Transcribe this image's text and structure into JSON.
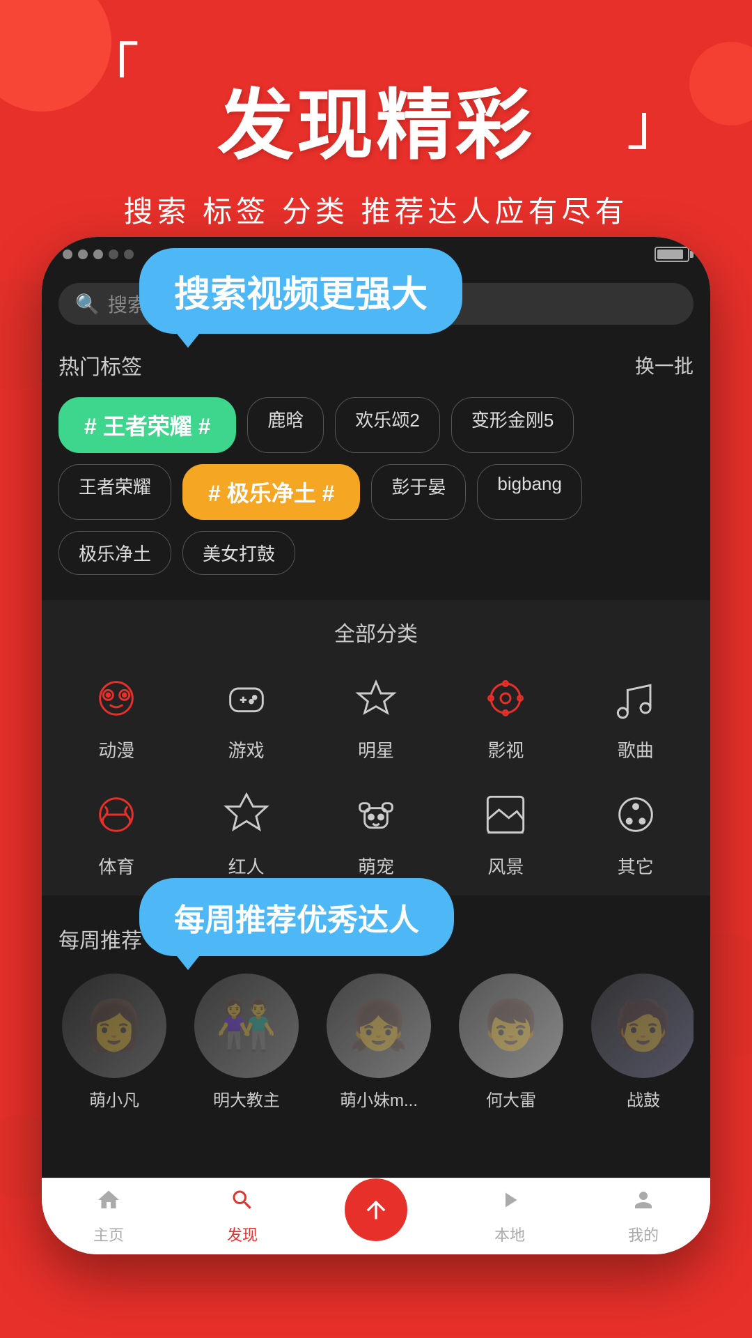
{
  "background": {
    "color": "#e8302a"
  },
  "header": {
    "bracket_open": "「",
    "bracket_close": "」",
    "title": "发现精彩",
    "subtitle": "搜索 标签 分类 推荐达人应有尽有"
  },
  "bubble_search": "搜索视频更强大",
  "bubble_recommend": "每周推荐优秀达人",
  "phone": {
    "statusbar_dots": [
      "filled",
      "filled",
      "filled",
      "empty",
      "empty"
    ],
    "search_placeholder": "搜索视频、标签、用户"
  },
  "hot_tags": {
    "title": "热门标签",
    "action": "换一批",
    "tags": [
      {
        "label": "# 王者荣耀 #",
        "style": "green"
      },
      {
        "label": "鹿晗",
        "style": "normal"
      },
      {
        "label": "欢乐颂2",
        "style": "normal"
      },
      {
        "label": "变形金刚5",
        "style": "normal"
      },
      {
        "label": "王者荣耀",
        "style": "normal"
      },
      {
        "label": "# 极乐净土 #",
        "style": "yellow"
      },
      {
        "label": "彭于晏",
        "style": "normal"
      },
      {
        "label": "bigbang",
        "style": "normal"
      },
      {
        "label": "极乐净土",
        "style": "normal"
      },
      {
        "label": "美女打鼓",
        "style": "normal"
      }
    ]
  },
  "categories": {
    "title": "全部分类",
    "items": [
      {
        "label": "动漫",
        "icon": "anime"
      },
      {
        "label": "游戏",
        "icon": "game"
      },
      {
        "label": "明星",
        "icon": "star"
      },
      {
        "label": "影视",
        "icon": "film"
      },
      {
        "label": "歌曲",
        "icon": "music"
      },
      {
        "label": "体育",
        "icon": "sports"
      },
      {
        "label": "红人",
        "icon": "person"
      },
      {
        "label": "萌宠",
        "icon": "pet"
      },
      {
        "label": "风景",
        "icon": "scenery"
      },
      {
        "label": "其它",
        "icon": "other"
      }
    ]
  },
  "recommended_users": {
    "users": [
      {
        "name": "萌小凡",
        "avatar_class": "av1"
      },
      {
        "name": "明大教主",
        "avatar_class": "av2"
      },
      {
        "name": "萌小妹m...",
        "avatar_class": "av3"
      },
      {
        "name": "何大雷",
        "avatar_class": "av4"
      },
      {
        "name": "战鼓",
        "avatar_class": "av5"
      }
    ]
  },
  "bottom_nav": {
    "items": [
      {
        "label": "主页",
        "icon": "home",
        "active": false
      },
      {
        "label": "发现",
        "icon": "search",
        "active": true
      },
      {
        "label": "",
        "icon": "upload",
        "active": false,
        "center": true
      },
      {
        "label": "本地",
        "icon": "video",
        "active": false
      },
      {
        "label": "我的",
        "icon": "user",
        "active": false
      }
    ]
  }
}
